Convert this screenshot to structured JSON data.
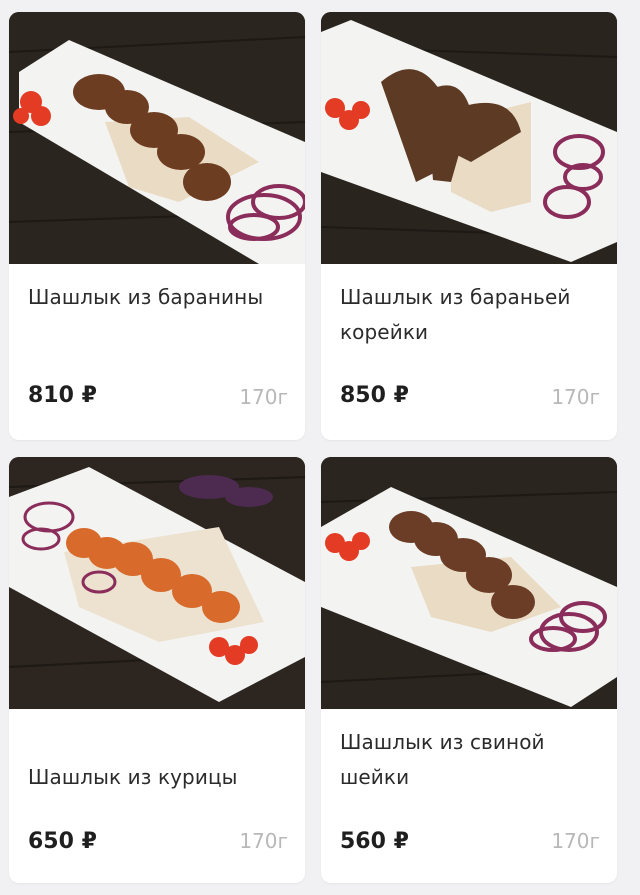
{
  "products": [
    {
      "name": "Шашлык из баранины",
      "price": "810 ₽",
      "weight": "170г"
    },
    {
      "name": "Шашлык из бараньей корейки",
      "price": "850 ₽",
      "weight": "170г"
    },
    {
      "name": "Шашлык из курицы",
      "price": "650 ₽",
      "weight": "170г"
    },
    {
      "name": "Шашлык из свиной шейки",
      "price": "560 ₽",
      "weight": "170г"
    }
  ],
  "colors": {
    "page_background": "#f1f1f3",
    "card_background": "#ffffff",
    "price_text": "#1f1f1f",
    "weight_text": "#b8b8b8"
  }
}
